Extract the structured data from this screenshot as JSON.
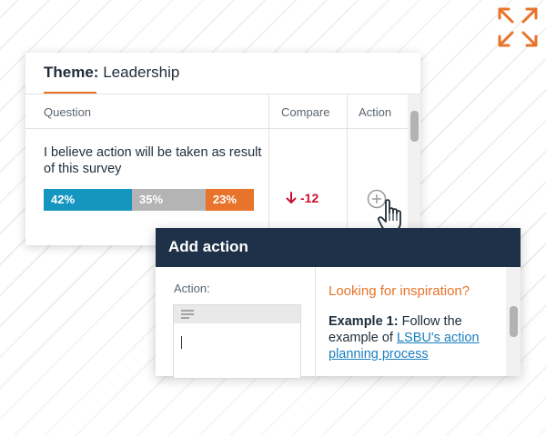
{
  "theme_card": {
    "title_prefix": "Theme:",
    "title_value": "Leadership",
    "columns": [
      "Question",
      "Compare",
      "Action"
    ],
    "question": "I believe action will be taken as result of this survey",
    "bar": {
      "segments": [
        {
          "label": "42%",
          "value": 42,
          "color": "#1596c1"
        },
        {
          "label": "35%",
          "value": 35,
          "color": "#b4b4b4"
        },
        {
          "label": "23%",
          "value": 23,
          "color": "#e8732a"
        }
      ]
    },
    "compare_value": "-12",
    "compare_icon": "arrow-down-icon",
    "action_icon": "add-circle-icon"
  },
  "action_card": {
    "title": "Add action",
    "action_label": "Action:",
    "editor_icon": "text-lines-icon",
    "inspiration_title": "Looking for inspiration?",
    "example_label": "Example 1:",
    "example_text": "Follow the example of",
    "example_link": "LSBU's action planning process"
  },
  "colors": {
    "accent": "#e8732a",
    "navy": "#1e3148",
    "negative": "#c8102e",
    "link": "#1a7fbf"
  }
}
